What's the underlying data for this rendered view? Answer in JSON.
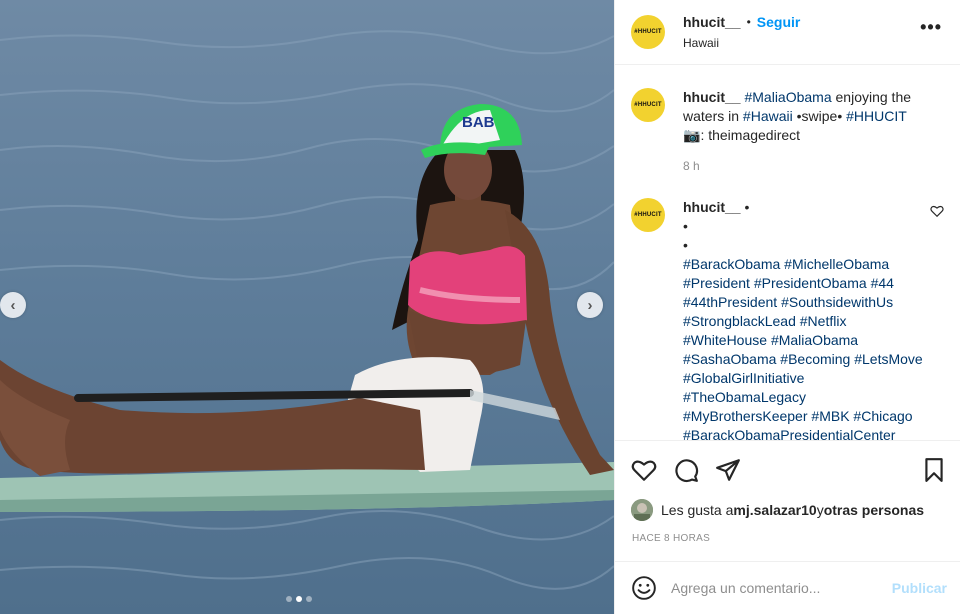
{
  "header": {
    "username": "hhucit__",
    "separator": "•",
    "follow_label": "Seguir",
    "location": "Hawaii",
    "avatar_text": "#HHUCIT",
    "more_label": "•••"
  },
  "caption": {
    "username": "hhucit__",
    "tag1": "#MaliaObama",
    "text1": " enjoying the waters in ",
    "tag2": "#Hawaii",
    "text2": " •swipe• ",
    "tag3": "#HHUCIT",
    "camera": "📷",
    "credit": ": theimagedirect",
    "time": "8 h"
  },
  "comment2": {
    "username": "hhucit__",
    "sep": " •",
    "bullet1": "•",
    "bullet2": "•",
    "hashtags": [
      "#BarackObama",
      "#MichelleObama",
      "#President",
      "#PresidentObama",
      "#44",
      "#44thPresident",
      "#SouthsidewithUs",
      "#StrongblackLead",
      "#Netflix",
      "#WhiteHouse",
      "#MaliaObama",
      "#SashaObama",
      "#Becoming",
      "#LetsMove",
      "#GlobalGirlInitiative",
      "#TheObamaLegacy",
      "#MyBrothersKeeper",
      "#MBK",
      "#Chicago",
      "#BarackObamaPresidentialCenter"
    ]
  },
  "likes": {
    "prefix": "Les gusta a ",
    "user": "mj.salazar10",
    "middle": " y ",
    "others": "otras personas"
  },
  "time_ago": "HACE 8 HORAS",
  "add_comment": {
    "emoji_icon": "smile-icon",
    "placeholder": "Agrega un comentario...",
    "publish_label": "Publicar"
  },
  "photo": {
    "cap_text": "BAB",
    "slide_count": 3,
    "active_slide": 2
  },
  "colors": {
    "link": "#0095f6",
    "hashtag": "#00376b",
    "avatar": "#f2d22f",
    "muted": "#8e8e8e",
    "publish_disabled": "#b2dffc"
  }
}
